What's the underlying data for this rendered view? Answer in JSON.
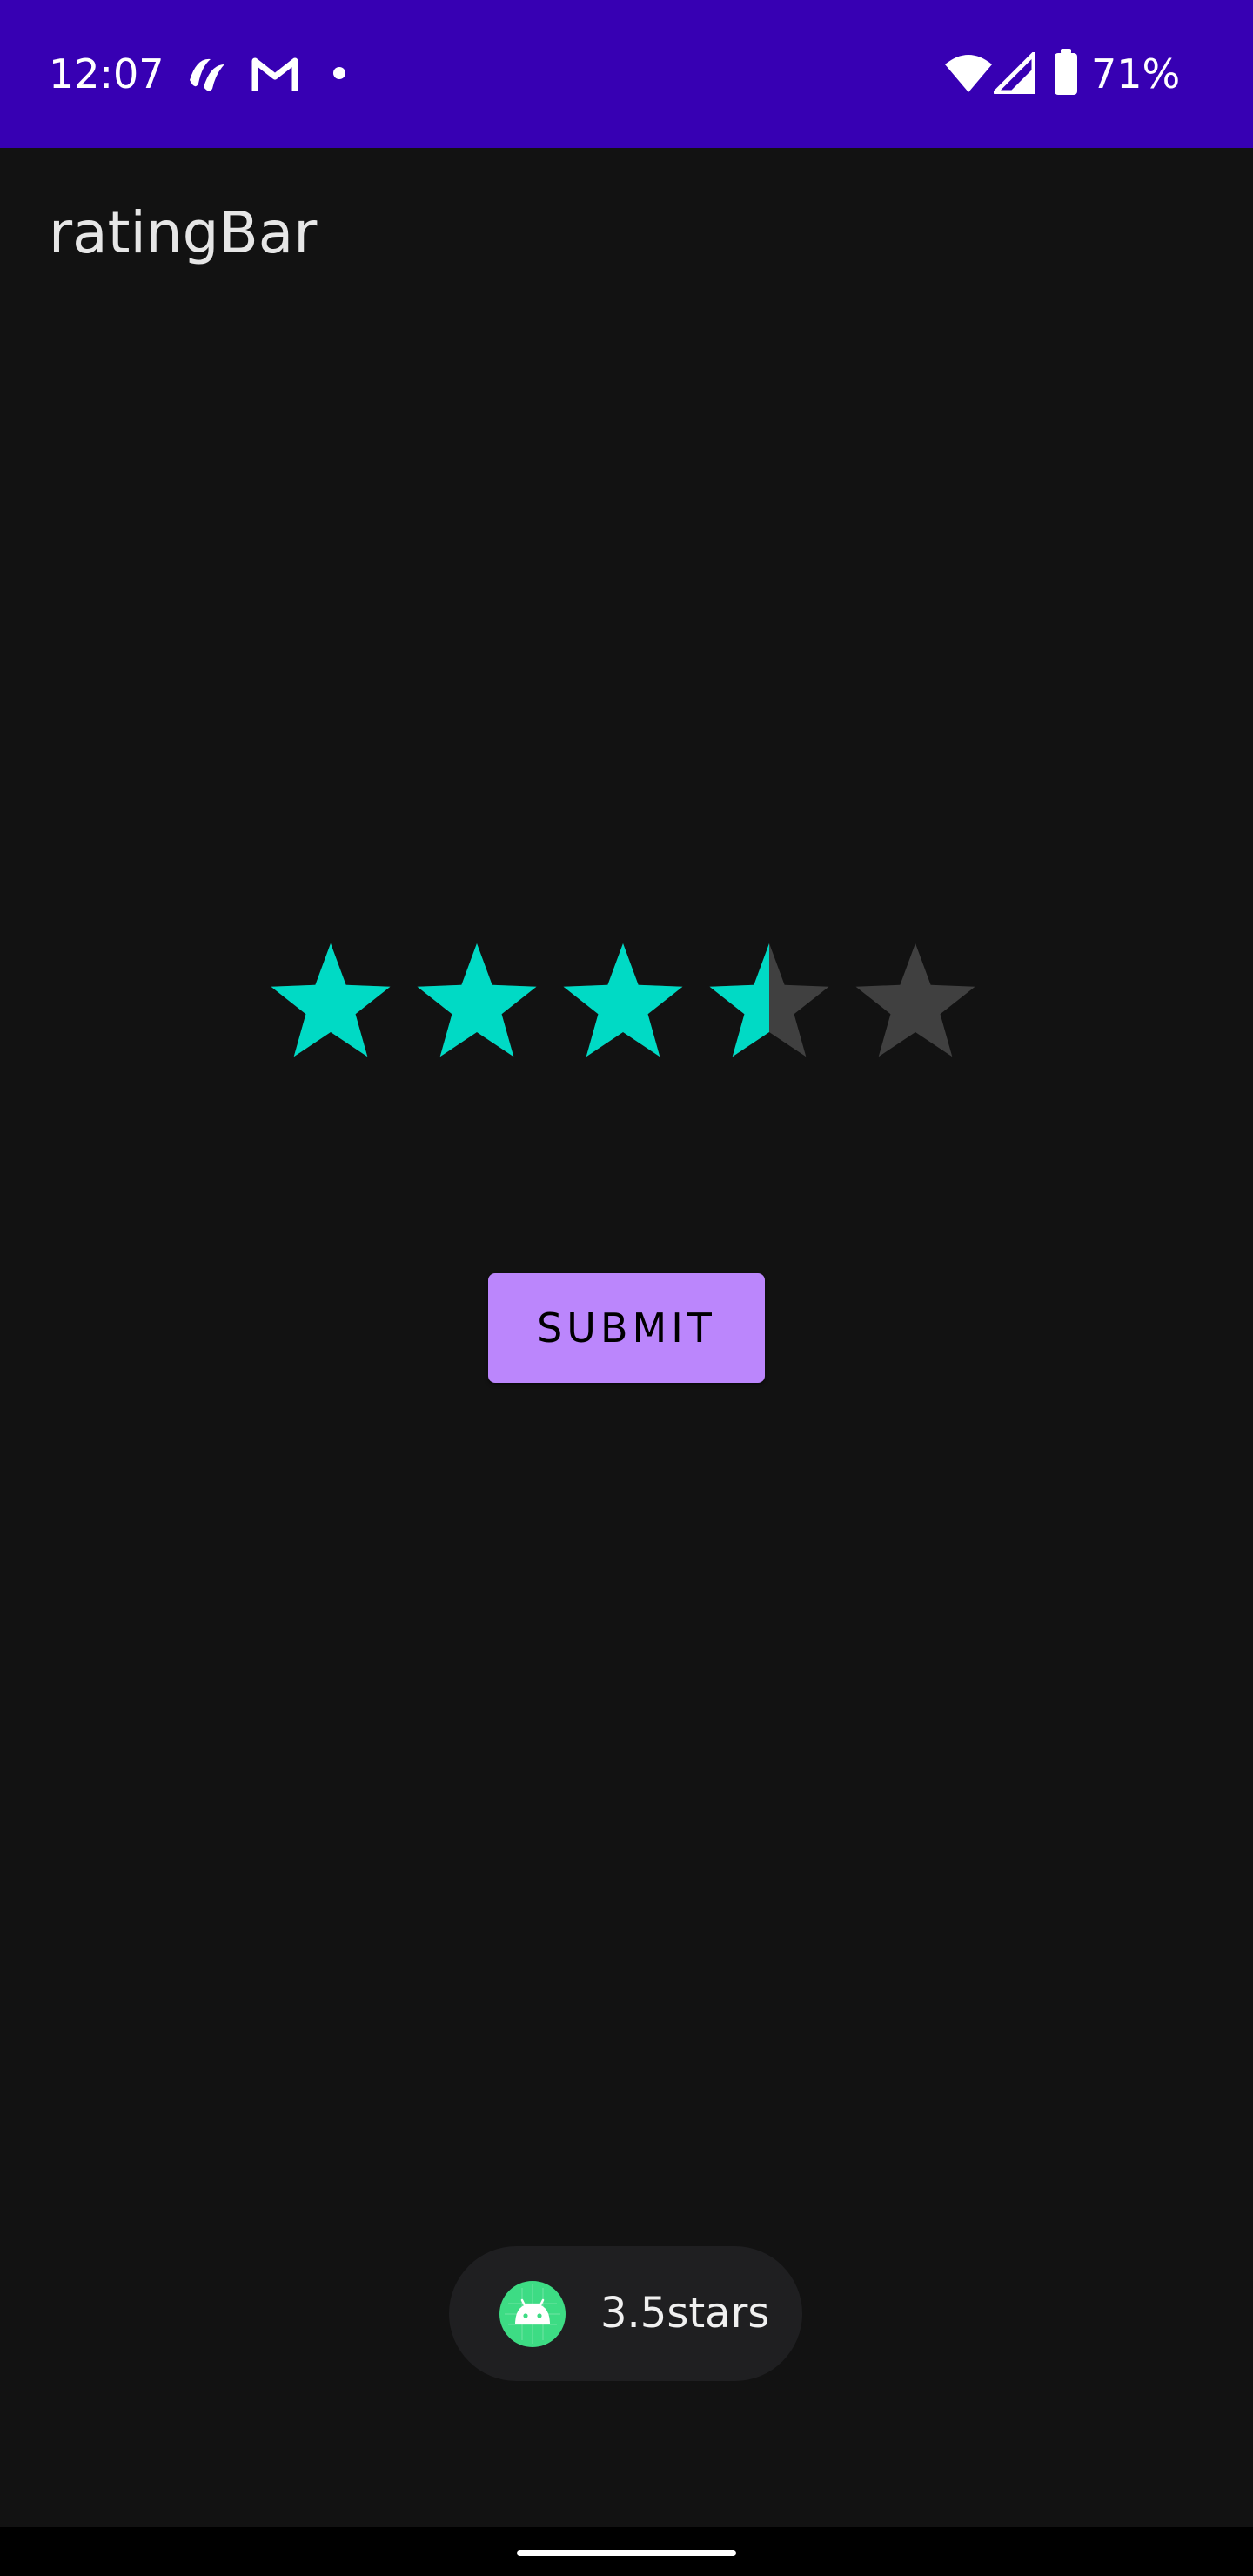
{
  "status_bar": {
    "time": "12:07",
    "battery_percent": "71%",
    "background_color": "#3700b3",
    "icons": [
      "app-notification-icon",
      "gmail-icon",
      "notification-dot-icon",
      "wifi-icon",
      "cellular-signal-icon",
      "battery-icon"
    ]
  },
  "app_bar": {
    "title": "ratingBar"
  },
  "rating": {
    "value": 3.5,
    "max": 5,
    "filled_color": "#00dac5",
    "empty_color": "#404040"
  },
  "submit_button": {
    "label": "SUBMIT",
    "color": "#bb86fc"
  },
  "toast": {
    "message": "3.5stars",
    "icon": "android-icon"
  }
}
